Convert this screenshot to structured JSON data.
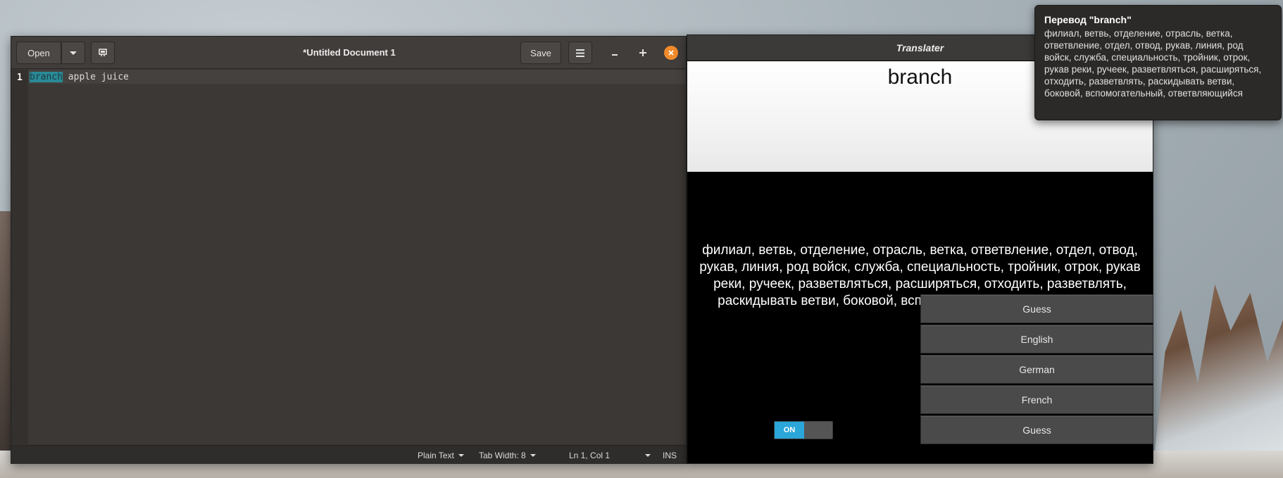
{
  "editor": {
    "title": "*Untitled Document 1",
    "open_label": "Open",
    "save_label": "Save",
    "line_number": "1",
    "selected_text": "branch",
    "rest_text": " apple juice",
    "status": {
      "language": "Plain Text",
      "tab_width": "Tab Width: 8",
      "position": "Ln 1, Col 1",
      "mode": "INS"
    }
  },
  "translater": {
    "title": "Translater",
    "input_word": "branch",
    "output_text": "филиал, ветвь, отделение, отрасль, ветка, ответвление, отдел, отвод, рукав, линия, род войск, служба, специальность, тройник, отрок, рукав реки, ручеек, разветвляться, расширяться, отходить, разветвлять, раскидывать ветви, боковой, вспомогательный, ответвляющийся",
    "toggle_label": "ON",
    "languages": [
      "Guess",
      "English",
      "German",
      "French",
      "Guess"
    ]
  },
  "notification": {
    "title": "Перевод \"branch\"",
    "body": "филиал, ветвь, отделение, отрасль, ветка, ответвление, отдел, отвод, рукав, линия, род войск, служба, специальность, тройник, отрок, рукав реки, ручеек, разветвляться, расширяться, отходить, разветвлять, раскидывать ветви, боковой, вспомогательный, ответвляющийся"
  },
  "icons": {
    "open_menu": "chevron-down-icon",
    "pin": "pin-icon",
    "menu": "hamburger-menu-icon",
    "minimize": "minimize-icon",
    "maximize": "maximize-icon",
    "close": "close-icon"
  },
  "colors": {
    "close_button": "#f08a2b",
    "selection": "#2a8a97",
    "toggle_on": "#2aa6d8"
  }
}
